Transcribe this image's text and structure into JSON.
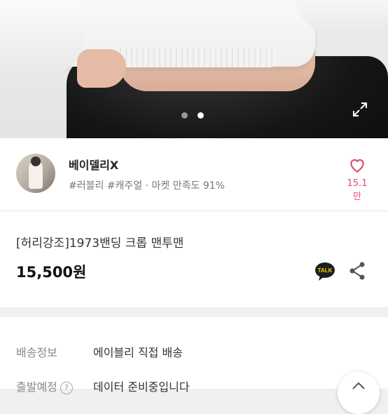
{
  "hero": {
    "slide_total": 2,
    "slide_current": 2
  },
  "seller": {
    "name": "베이델리X",
    "tags": "#러블리 #캐주얼 · 마켓 만족도 91%",
    "like_count": "15.1만"
  },
  "product": {
    "title": "[허리강조]1973밴딩 크롭 맨투맨",
    "price": "15,500원",
    "talk_label": "TALK"
  },
  "shipping": {
    "delivery_label": "배송정보",
    "delivery_value": "에이블리 직접 배송",
    "departure_label": "출발예정",
    "departure_help": "?",
    "departure_value": "데이터 준비중입니다"
  },
  "colors": {
    "accent": "#e04e6b",
    "talk_bg": "#1e1e1e"
  },
  "icons": [
    "expand-icon",
    "heart-icon",
    "kakao-talk-icon",
    "share-icon",
    "help-icon",
    "scroll-up-icon"
  ]
}
